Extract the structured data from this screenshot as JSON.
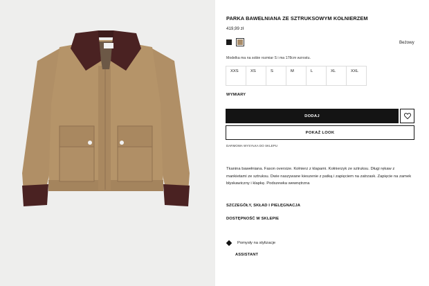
{
  "product": {
    "title": "PARKA BAWEŁNIANA ZE SZTRUKSOWYM KOŁNIERZEM",
    "price": "419,99 zł",
    "selected_color": "Beżowy",
    "colors": [
      {
        "name": "black-swatch",
        "hex": "#1a1a1a"
      },
      {
        "name": "beige-swatch",
        "hex": "#a88c6a"
      }
    ],
    "model_note": "Modelka ma na sobie rozmiar S i ma 178cm wzrostu.",
    "sizes": [
      "XXS",
      "XS",
      "S",
      "M",
      "L",
      "XL",
      "XXL"
    ],
    "dimensions_label": "WYMIARY",
    "add_label": "DODAJ",
    "look_label": "POKAŻ LOOK",
    "shipping_note": "DARMOWA WYSYŁKA DO SKLEPU",
    "description": "Tkanina bawełniana. Fason oversize. Kołnierz z klapami. Kołnierzyk ze sztruksu. Długi rękaw z mankietami ze sztruksu. Dwie naszywane kieszenie z patką i zapięciem na zatrzask. Zapięcie na zamek błyskawiczny i klapkę. Podszewka wewnętrzna",
    "details_link": "SZCZEGÓŁY, SKŁAD I PIELĘGNACJA",
    "store_link": "DOSTĘPNOŚĆ W SKLEPIE",
    "styling_label": "Pomysły na stylizacje",
    "assistant_label": "ASSISTANT"
  },
  "colors": {
    "image_bg": "#eeeeed",
    "jacket_body": "#b08f66",
    "jacket_shadow": "#8f7150",
    "corduroy": "#4a2222",
    "accent_dark": "#141414"
  },
  "icons": {
    "favorite": "heart-icon",
    "styling": "diamond-icon"
  }
}
